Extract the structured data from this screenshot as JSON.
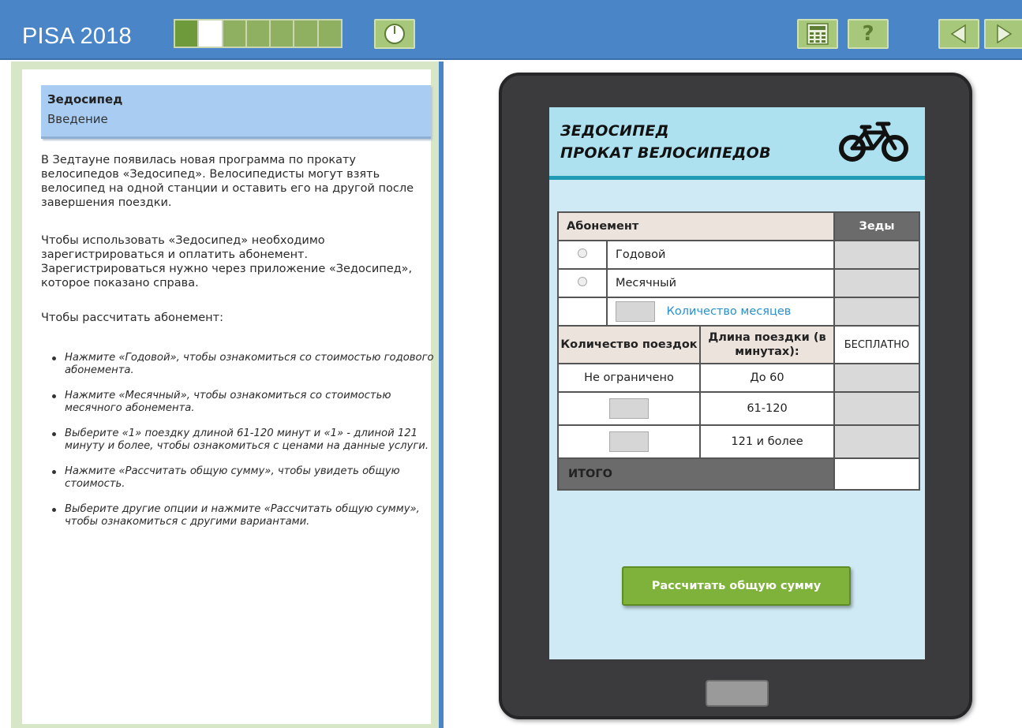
{
  "app": {
    "title": "PISA 2018"
  },
  "progress": {
    "total_segments": 7,
    "current_segment": 2
  },
  "toolbar": {
    "icons": [
      "timer-icon",
      "calculator-icon",
      "help-icon",
      "back-arrow-icon",
      "forward-arrow-icon"
    ],
    "help_glyph": "?"
  },
  "left": {
    "unit_title": "Зедосипед",
    "unit_subtitle": "Введение",
    "paragraph1": "В Зедтауне появилась новая программа по прокату велосипедов «Зедосипед». Велосипедисты могут взять велосипед на одной станции и оставить его на другой после завершения поездки.",
    "paragraph2": "Чтобы использовать «Зедосипед» необходимо зарегистрироваться и оплатить абонемент. Зарегистрироваться нужно через приложение «Зедосипед», которое показано справа.",
    "paragraph3": "Чтобы рассчитать абонемент:",
    "bullets": [
      "Нажмите «Годовой», чтобы ознакомиться со стоимостью годового абонемента.",
      "Нажмите «Месячный», чтобы ознакомиться со стоимостью месячного абонемента.",
      "Выберите «1» поездку длиной 61-120 минут и «1» - длиной 121 минуту и более, чтобы ознакомиться с ценами на данные услуги.",
      "Нажмите «Рассчитать общую сумму», чтобы увидеть общую стоимость.",
      "Выберите другие опции и нажмите «Рассчитать общую сумму», чтобы ознакомиться с другими вариантами."
    ]
  },
  "app_screen": {
    "title_line1": "ЗЕДОСИПЕД",
    "title_line2": "ПРОКАТ ВЕЛОСИПЕДОВ",
    "table": {
      "subscription_header": "Абонемент",
      "zeds_header": "Зеды",
      "option_yearly": "Годовой",
      "option_monthly": "Месячный",
      "months_label": "Количество месяцев",
      "rides_header": "Количество поездок",
      "duration_header": "Длина поездки (в минутах):",
      "free_header": "БЕСПЛАТНО",
      "unlimited": "Не ограничено",
      "dur_1": "До 60",
      "dur_2": "61-120",
      "dur_3": "121 и более",
      "total_label": "ИТОГО"
    },
    "calculate_button": "Рассчитать общую сумму"
  },
  "colors": {
    "topbar": "#4a85c8",
    "accent_green": "#7fb23a",
    "link_blue": "#2a8fc9"
  }
}
